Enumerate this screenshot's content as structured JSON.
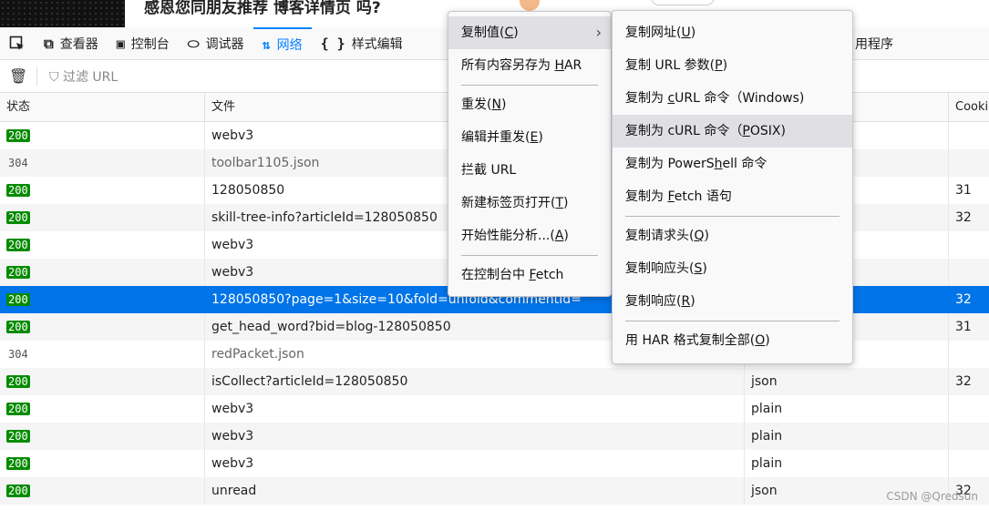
{
  "page": {
    "title": "感恩您同朋友推荐 博客详情页 吗?",
    "watermark": "CSDN @Qredsun"
  },
  "toolbar": {
    "tabs": [
      {
        "icon": "⧉",
        "label": "查看器"
      },
      {
        "icon": "▣",
        "label": "控制台"
      },
      {
        "icon": "⬭",
        "label": "调试器"
      },
      {
        "icon": "⇅",
        "label": "网络"
      },
      {
        "icon": "{ }",
        "label": "样式编辑"
      }
    ],
    "right_tab_label": "用程序"
  },
  "filter": {
    "placeholder": "过滤 URL"
  },
  "table": {
    "headers": [
      "状态",
      "文件",
      "",
      "Cooki"
    ],
    "rows": [
      {
        "status": "200",
        "file": "webv3",
        "type": "",
        "cookie": ""
      },
      {
        "status": "304",
        "file": "toolbar1105.json",
        "type": "",
        "cookie": ""
      },
      {
        "status": "200",
        "file": "128050850",
        "type": "",
        "cookie": "31"
      },
      {
        "status": "200",
        "file": "skill-tree-info?articleId=128050850",
        "type": "",
        "cookie": "32"
      },
      {
        "status": "200",
        "file": "webv3",
        "type": "",
        "cookie": ""
      },
      {
        "status": "200",
        "file": "webv3",
        "type": "",
        "cookie": ""
      },
      {
        "status": "200",
        "file": "128050850?page=1&size=10&fold=unfold&commentId=",
        "type": "",
        "cookie": "32"
      },
      {
        "status": "200",
        "file": "get_head_word?bid=blog-128050850",
        "type": "",
        "cookie": "31"
      },
      {
        "status": "304",
        "file": "redPacket.json",
        "type": "",
        "cookie": ""
      },
      {
        "status": "200",
        "file": "isCollect?articleId=128050850",
        "type": "json",
        "cookie": "32"
      },
      {
        "status": "200",
        "file": "webv3",
        "type": "plain",
        "cookie": ""
      },
      {
        "status": "200",
        "file": "webv3",
        "type": "plain",
        "cookie": ""
      },
      {
        "status": "200",
        "file": "webv3",
        "type": "plain",
        "cookie": ""
      },
      {
        "status": "200",
        "file": "unread",
        "type": "json",
        "cookie": "32"
      }
    ]
  },
  "context_menu": {
    "items": [
      {
        "pre": "复制值(",
        "key": "C",
        "post": ")"
      },
      {
        "pre": "所有内容另存为 ",
        "key": "H",
        "post": "AR"
      },
      {
        "pre": "重发(",
        "key": "N",
        "post": ")"
      },
      {
        "pre": "编辑并重发(",
        "key": "E",
        "post": ")"
      },
      {
        "pre": "拦截 URL",
        "key": "",
        "post": ""
      },
      {
        "pre": "新建标签页打开(",
        "key": "T",
        "post": ")"
      },
      {
        "pre": "开始性能分析...(",
        "key": "A",
        "post": ")"
      },
      {
        "pre": "在控制台中 ",
        "key": "F",
        "post": "etch"
      }
    ]
  },
  "submenu": {
    "items": [
      {
        "pre": "复制网址(",
        "key": "U",
        "post": ")"
      },
      {
        "pre": "复制 URL 参数(",
        "key": "P",
        "post": ")"
      },
      {
        "pre": "复制为 ",
        "key": "c",
        "post": "URL 命令（Windows)"
      },
      {
        "pre": "复制为 cURL 命令（",
        "key": "P",
        "post": "OSIX)"
      },
      {
        "pre": "复制为 PowerS",
        "key": "h",
        "post": "ell 命令"
      },
      {
        "pre": "复制为 ",
        "key": "F",
        "post": "etch 语句"
      },
      {
        "pre": "复制请求头(",
        "key": "Q",
        "post": ")"
      },
      {
        "pre": "复制响应头(",
        "key": "S",
        "post": ")"
      },
      {
        "pre": "复制响应(",
        "key": "R",
        "post": ")"
      },
      {
        "pre": "用 HAR 格式复制全部(",
        "key": "O",
        "post": ")"
      }
    ]
  },
  "colors": {
    "accent": "#0a84ff",
    "selected_row": "#0074e8",
    "status_ok": "#058b00"
  }
}
